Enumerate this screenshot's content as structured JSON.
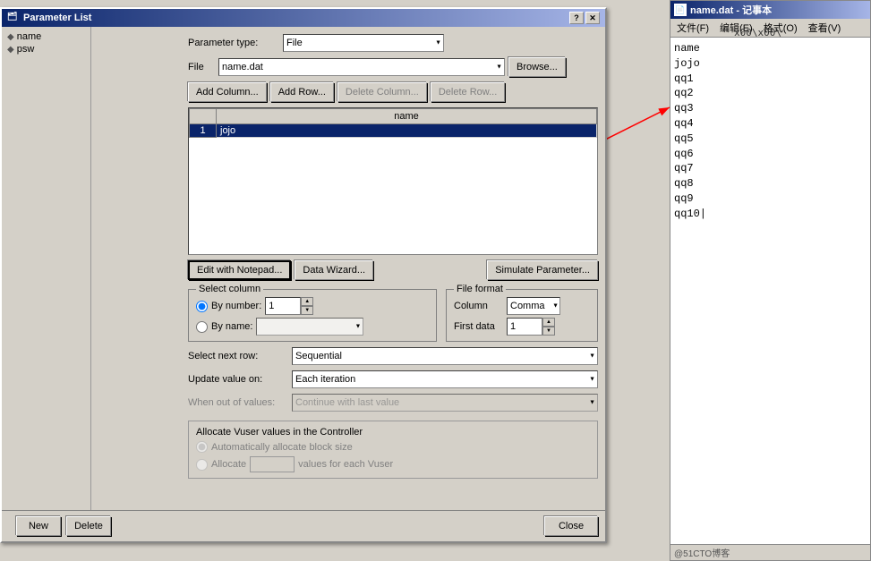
{
  "notepad": {
    "title": "name.dat - 记事本",
    "menu": [
      "文件(F)",
      "编辑(E)",
      "格式(O)",
      "查看(V)"
    ],
    "content": [
      "name",
      "jojo",
      "qq1",
      "qq2",
      "qq3",
      "qq4",
      "qq5",
      "qq6",
      "qq7",
      "qq8",
      "qq9",
      "qq10"
    ],
    "watermark": "@51CTO博客"
  },
  "dialog": {
    "title": "Parameter List",
    "param_type_label": "Parameter type:",
    "param_type_value": "File",
    "file_label": "File",
    "file_value": "name.dat",
    "browse_label": "Browse...",
    "add_column_label": "Add Column...",
    "add_row_label": "Add Row...",
    "delete_column_label": "Delete Column...",
    "delete_row_label": "Delete Row...",
    "table_column": "name",
    "table_rows": [
      {
        "num": "1",
        "value": "jojo"
      }
    ],
    "edit_notepad_label": "Edit with Notepad...",
    "data_wizard_label": "Data Wizard...",
    "simulate_label": "Simulate Parameter...",
    "select_column_title": "Select column",
    "by_number_label": "By number:",
    "by_number_value": "1",
    "by_name_label": "By name:",
    "file_format_title": "File format",
    "column_label": "Column",
    "column_value": "Comma",
    "first_data_label": "First data",
    "first_data_value": "1",
    "select_next_row_label": "Select next row:",
    "select_next_row_value": "Sequential",
    "update_value_label": "Update value on:",
    "update_value_value": "Each iteration",
    "when_out_label": "When out of values:",
    "when_out_value": "Continue with last value",
    "allocate_title": "Allocate Vuser values in the Controller",
    "auto_allocate_label": "Automatically allocate block size",
    "allocate_label": "Allocate",
    "values_label": "values for each Vuser",
    "close_label": "Close",
    "new_label": "New",
    "delete_label": "Delete"
  },
  "param_list": {
    "items": [
      {
        "icon": "◆",
        "name": "name"
      },
      {
        "icon": "◆",
        "name": "psw"
      }
    ]
  },
  "hex_display": "x00\\x00\\"
}
